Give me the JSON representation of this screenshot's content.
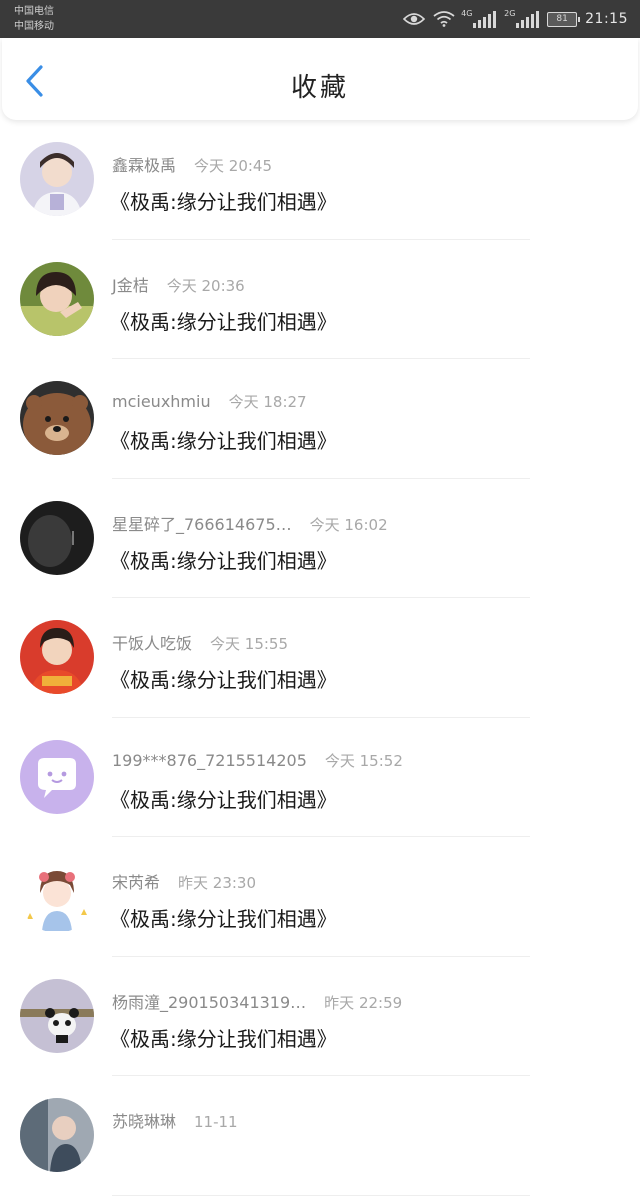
{
  "status_bar": {
    "carrier_1": "中国电信",
    "carrier_2": "中国移动",
    "signal_1_tag": "4G",
    "signal_2_tag": "2G",
    "battery": "81",
    "time": "21:15"
  },
  "header": {
    "title": "收藏",
    "back_icon": "chevron-left-icon",
    "accent_color": "#3a8ee6"
  },
  "items": [
    {
      "name": "鑫霖极禹",
      "time": "今天 20:45",
      "title": "《极禹:缘分让我们相遇》"
    },
    {
      "name": "J金桔",
      "time": "今天 20:36",
      "title": "《极禹:缘分让我们相遇》"
    },
    {
      "name": "mcieuxhmiu",
      "time": "今天 18:27",
      "title": "《极禹:缘分让我们相遇》"
    },
    {
      "name": "星星碎了_766614675…",
      "time": "今天 16:02",
      "title": "《极禹:缘分让我们相遇》"
    },
    {
      "name": "干饭人吃饭",
      "time": "今天 15:55",
      "title": "《极禹:缘分让我们相遇》"
    },
    {
      "name": "199***876_7215514205",
      "time": "今天 15:52",
      "title": "《极禹:缘分让我们相遇》"
    },
    {
      "name": "宋芮希",
      "time": "昨天 23:30",
      "title": "《极禹:缘分让我们相遇》"
    },
    {
      "name": "杨雨潼_290150341319…",
      "time": "昨天 22:59",
      "title": "《极禹:缘分让我们相遇》"
    },
    {
      "name": "苏晓琳琳",
      "time": "11-11",
      "title": ""
    }
  ]
}
